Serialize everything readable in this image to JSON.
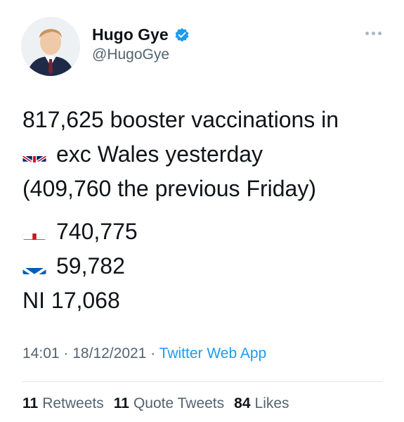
{
  "author": {
    "name": "Hugo Gye",
    "handle": "@HugoGye",
    "verified": true,
    "avatar_icon": "person-avatar-photo"
  },
  "tweet": {
    "line1": "817,625 booster vaccinations in",
    "line2": "exc Wales yesterday",
    "line3": "(409,760 the previous Friday)",
    "england_value": "740,775",
    "scotland_value": "59,782",
    "ni_line": "NI 17,068"
  },
  "meta": {
    "time": "14:01",
    "separator": "·",
    "date": "18/12/2021",
    "app": "Twitter Web App"
  },
  "stats": {
    "retweets_count": "11",
    "retweets_label": "Retweets",
    "quotes_count": "11",
    "quotes_label": "Quote Tweets",
    "likes_count": "84",
    "likes_label": "Likes"
  },
  "colors": {
    "accent": "#1d9bf0",
    "secondary_text": "#536471",
    "primary_text": "#0f1419"
  }
}
